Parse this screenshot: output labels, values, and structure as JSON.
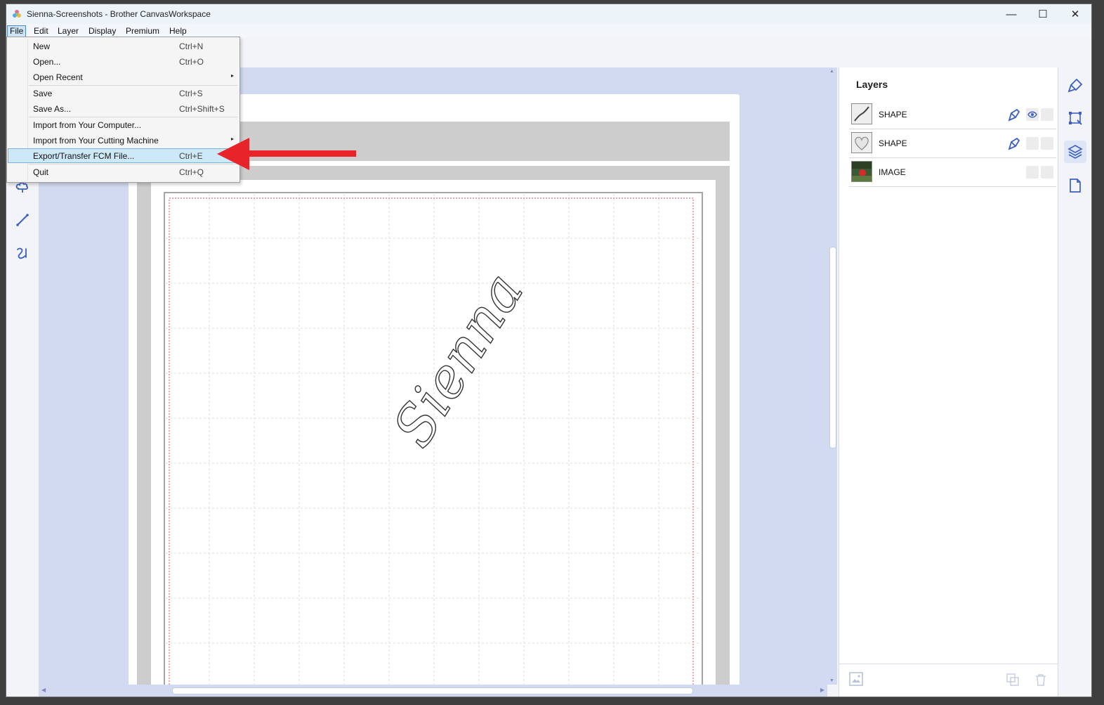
{
  "window": {
    "title": "Sienna-Screenshots - Brother CanvasWorkspace",
    "minimize": "—",
    "maximize": "☐",
    "close": "✕"
  },
  "menubar": [
    "File",
    "Edit",
    "Layer",
    "Display",
    "Premium",
    "Help"
  ],
  "file_menu": [
    {
      "label": "New",
      "shortcut": "Ctrl+N"
    },
    {
      "label": "Open...",
      "shortcut": "Ctrl+O"
    },
    {
      "label": "Open Recent",
      "shortcut": "",
      "submenu": "▸"
    },
    {
      "label": "Save",
      "shortcut": "Ctrl+S"
    },
    {
      "label": "Save As...",
      "shortcut": "Ctrl+Shift+S"
    },
    {
      "label": "Import from Your Computer...",
      "shortcut": ""
    },
    {
      "label": "Import from Your Cutting Machine",
      "shortcut": "",
      "submenu": "▸"
    },
    {
      "label": "Export/Transfer FCM File...",
      "shortcut": "Ctrl+E"
    },
    {
      "label": "Quit",
      "shortcut": "Ctrl+Q"
    }
  ],
  "highlighted_item": "Export/Transfer FCM File...",
  "canvas": {
    "text": "Sienna"
  },
  "layers": {
    "title": "Layers",
    "items": [
      {
        "name": "SHAPE",
        "thumb": "sienna-text"
      },
      {
        "name": "SHAPE",
        "thumb": "heart"
      },
      {
        "name": "IMAGE",
        "thumb": "photo"
      }
    ]
  },
  "colors": {
    "accent": "#3c5fc4",
    "canvas_bg": "#d1daf0",
    "arrow": "#e8232a",
    "cut_line": "#e05050"
  },
  "icons": [
    "brush-icon",
    "transform-icon",
    "layers-icon",
    "page-icon",
    "eye-icon",
    "pen-icon",
    "duplicate-icon",
    "trash-icon",
    "add-image-icon"
  ]
}
